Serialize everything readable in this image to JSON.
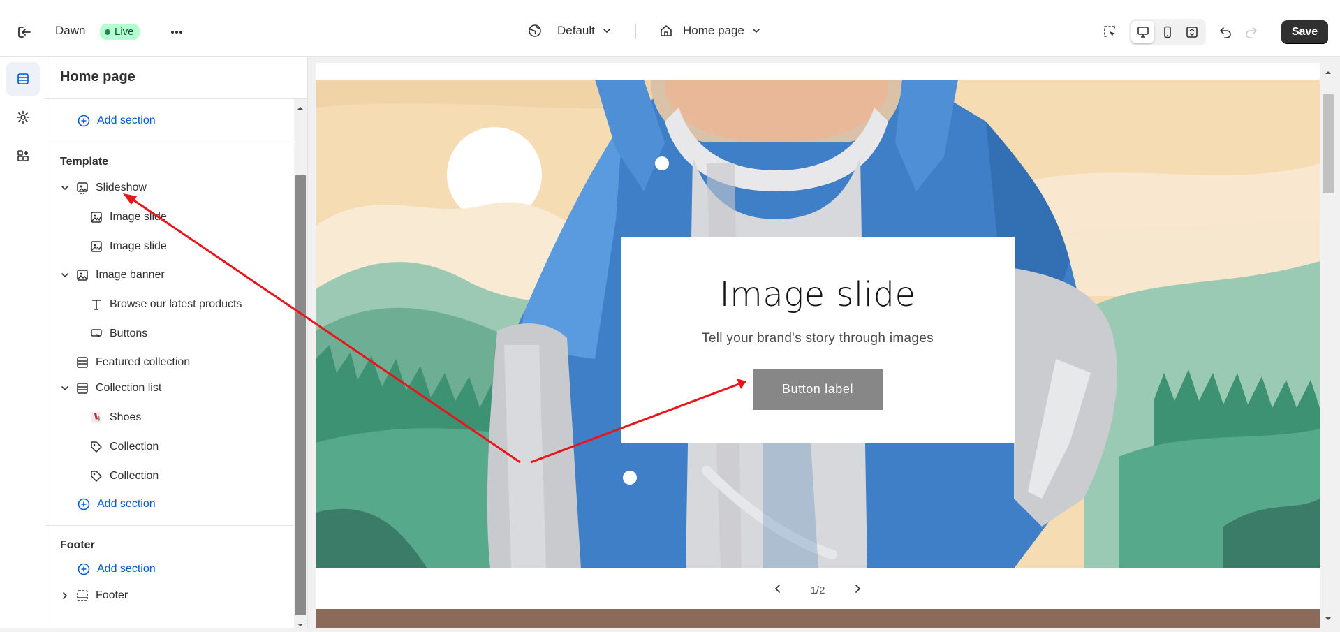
{
  "topbar": {
    "theme_name": "Dawn",
    "status_badge": "Live",
    "more_label": "•••",
    "theme_selector": "Default",
    "page_selector": "Home page",
    "save_label": "Save"
  },
  "panel": {
    "title": "Home page",
    "header_add_section": "Add section",
    "template_label": "Template",
    "items": [
      {
        "label": "Slideshow",
        "icon": "slideshow-icon",
        "level": 0,
        "expanded": true
      },
      {
        "label": "Image slide",
        "icon": "image-slide-icon",
        "level": 1
      },
      {
        "label": "Image slide",
        "icon": "image-slide-icon",
        "level": 1
      },
      {
        "label": "Image banner",
        "icon": "image-icon",
        "level": 0,
        "expanded": true
      },
      {
        "label": "Browse our latest products",
        "icon": "text-icon",
        "level": 1
      },
      {
        "label": "Buttons",
        "icon": "button-icon",
        "level": 1
      },
      {
        "label": "Featured collection",
        "icon": "section-icon",
        "level": 0
      },
      {
        "label": "Collection list",
        "icon": "section-icon",
        "level": 0,
        "expanded": true
      },
      {
        "label": "Shoes",
        "icon": "product-thumbnail",
        "level": 1
      },
      {
        "label": "Collection",
        "icon": "tag-icon",
        "level": 1
      },
      {
        "label": "Collection",
        "icon": "tag-icon",
        "level": 1
      }
    ],
    "template_add_section": "Add section",
    "footer_label": "Footer",
    "footer_add_section": "Add section",
    "footer_item": "Footer"
  },
  "preview": {
    "slide_heading": "Image slide",
    "slide_subheading": "Tell your brand's story through images",
    "slide_button": "Button label",
    "pager": "1/2"
  },
  "colors": {
    "accent_blue": "#005bd3",
    "live_badge_bg": "#b4fed2",
    "save_button_bg": "#303030",
    "annotation_arrow": "#e8161b"
  }
}
